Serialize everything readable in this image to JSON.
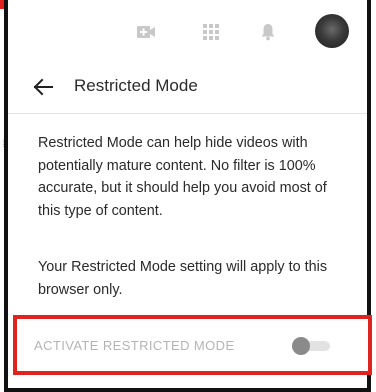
{
  "header": {
    "title": "Restricted Mode"
  },
  "topbar": {
    "icons": [
      "create-video-icon",
      "apps-icon",
      "notifications-bell-icon"
    ],
    "avatar": "account-avatar"
  },
  "content": {
    "description": "Restricted Mode can help hide videos with potentially mature content. No filter is 100% accurate, but it should help you avoid most of this type of content.",
    "note": "Your Restricted Mode setting will apply to this browser only."
  },
  "toggle": {
    "label": "ACTIVATE RESTRICTED MODE",
    "state": "off"
  },
  "colors": {
    "highlight": "#e0231f",
    "frame": "#111111",
    "disabled_text": "#b4b4b4"
  }
}
